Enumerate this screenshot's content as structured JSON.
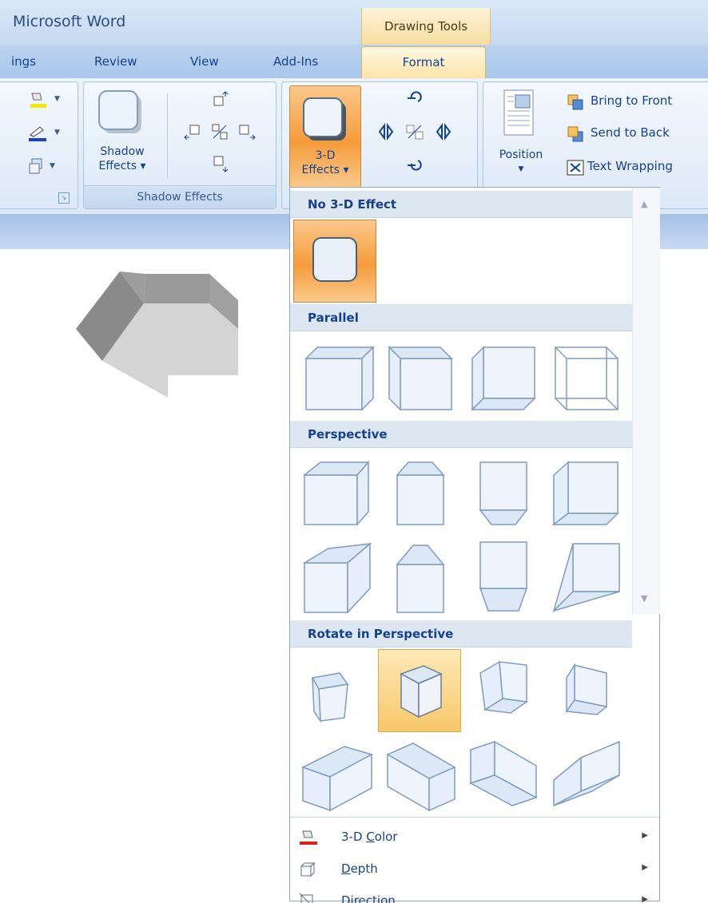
{
  "app_title": "Microsoft Word",
  "contextual_tab_group": "Drawing Tools",
  "tabs": [
    "ings",
    "Review",
    "View",
    "Add-Ins"
  ],
  "active_tab": "Format",
  "ribbon": {
    "shadow_effects_button": [
      "Shadow",
      "Effects ▾"
    ],
    "shadow_group_label": "Shadow Effects",
    "threed_button": [
      "3-D",
      "Effects ▾"
    ],
    "position_label": "Position",
    "arrange": {
      "bring_to_front": "Bring to Front",
      "send_to_back": "Send to Back",
      "text_wrapping": "Text Wrapping"
    }
  },
  "gallery": {
    "sections": [
      "No 3-D Effect",
      "Parallel",
      "Perspective",
      "Rotate in Perspective"
    ],
    "menu": [
      {
        "label": "3-D Color",
        "accel": "C",
        "icon": "paint-bucket-icon"
      },
      {
        "label": "Depth",
        "accel": "D",
        "icon": "depth-icon"
      },
      {
        "label": "Direction",
        "accel": "",
        "icon": "direction-icon"
      }
    ]
  },
  "colors": {
    "accent_orange": "#f59b3b",
    "hover_yellow": "#f8c76a",
    "ribbon_blue": "#dce8f6",
    "text_blue": "#15428b"
  }
}
